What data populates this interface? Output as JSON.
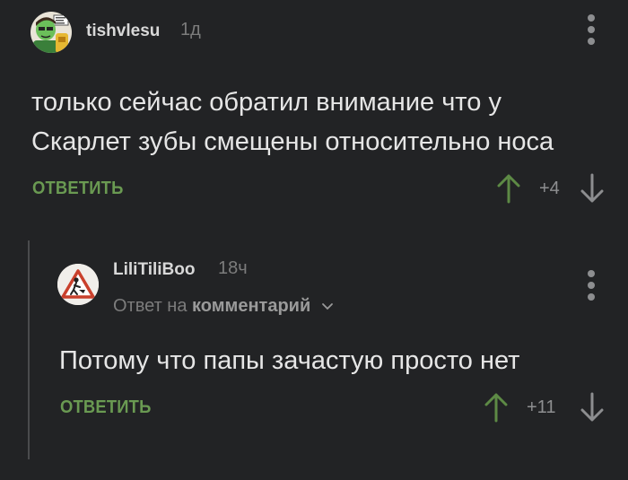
{
  "colors": {
    "background": "#222325",
    "reply_green": "#6a9a52",
    "arrow_green": "#5d8a45",
    "muted_text": "#7c7c7c",
    "thread_line": "#4a4b4d"
  },
  "comments": [
    {
      "username": "tishvlesu",
      "time": "1д",
      "avatar_icon": "cartoon-avatar-icon",
      "text": "только сейчас обратил внимание что у Скарлет зубы смещены относительно носа",
      "reply_label": "ОТВЕТИТЬ",
      "rating": "+4",
      "more_icon": "more-vertical-icon"
    },
    {
      "username": "LiliTiliBoo",
      "time": "18ч",
      "avatar_icon": "road-sign-avatar-icon",
      "reply_to_prefix": "Ответ на",
      "reply_to_target": "комментарий",
      "text": "Потому что папы зачастую просто нет",
      "reply_label": "ОТВЕТИТЬ",
      "rating": "+11",
      "more_icon": "more-vertical-icon"
    }
  ]
}
